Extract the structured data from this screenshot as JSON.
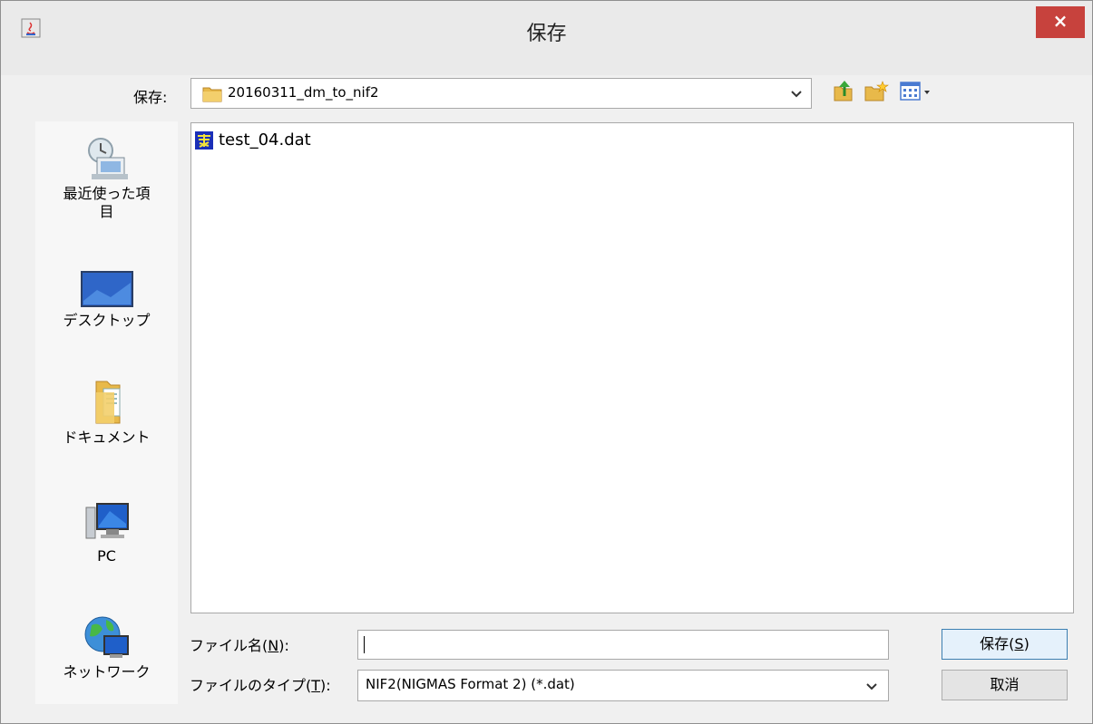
{
  "window": {
    "title": "保存",
    "close_glyph": "×"
  },
  "toolbar": {
    "save_in_label": "保存:",
    "current_folder": "20160311_dm_to_nif2",
    "icons": [
      "up-folder-icon",
      "new-folder-icon",
      "view-menu-icon"
    ]
  },
  "sidebar": {
    "items": [
      {
        "label_line1": "最近使った項",
        "label_line2": "目",
        "icon": "recent-items-icon"
      },
      {
        "label": "デスクトップ",
        "icon": "desktop-icon"
      },
      {
        "label": "ドキュメント",
        "icon": "documents-icon"
      },
      {
        "label": "PC",
        "icon": "pc-icon"
      },
      {
        "label": "ネットワーク",
        "icon": "network-icon"
      }
    ]
  },
  "files": [
    {
      "name": "test_04.dat",
      "icon": "data-file-icon"
    }
  ],
  "form": {
    "filename_label": "ファイル名(",
    "filename_mnemonic": "N",
    "filename_label_end": "):",
    "filename_value": "",
    "type_label": "ファイルのタイプ(",
    "type_mnemonic": "T",
    "type_label_end": "):",
    "type_value": "NIF2(NIGMAS Format 2) (*.dat)"
  },
  "buttons": {
    "save_label": "保存(",
    "save_mnemonic": "S",
    "save_end": ")",
    "cancel_label": "取消"
  }
}
